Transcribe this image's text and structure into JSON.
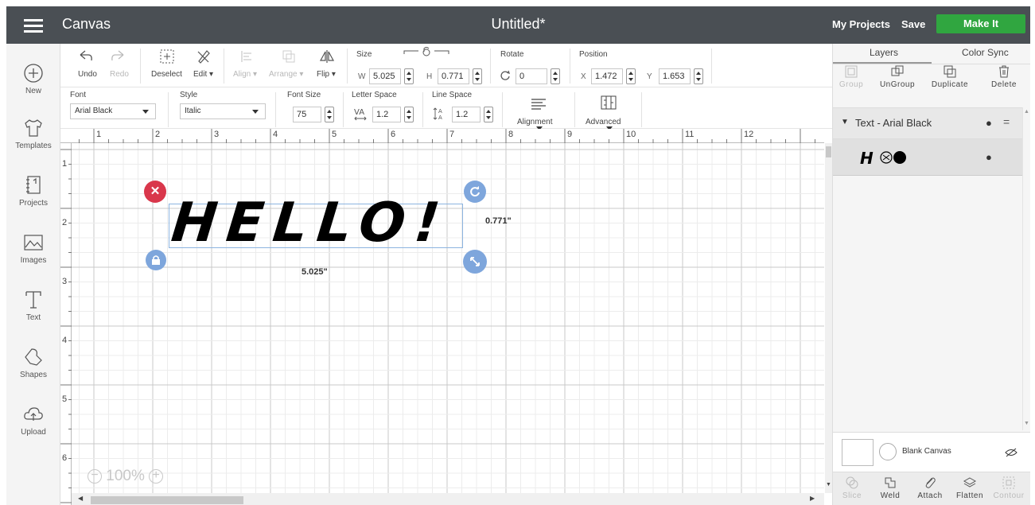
{
  "header": {
    "app_title": "Canvas",
    "doc_title": "Untitled*",
    "my_projects": "My Projects",
    "save": "Save",
    "make_it": "Make It"
  },
  "sidebar": {
    "items": [
      {
        "label": "New",
        "icon": "plus-circle-icon"
      },
      {
        "label": "Templates",
        "icon": "shirt-icon"
      },
      {
        "label": "Projects",
        "icon": "notebook-icon"
      },
      {
        "label": "Images",
        "icon": "image-icon"
      },
      {
        "label": "Text",
        "icon": "text-icon"
      },
      {
        "label": "Shapes",
        "icon": "shapes-icon"
      },
      {
        "label": "Upload",
        "icon": "cloud-upload-icon"
      }
    ]
  },
  "toolbar": {
    "undo": "Undo",
    "redo": "Redo",
    "deselect": "Deselect",
    "edit": "Edit",
    "align": "Align",
    "arrange": "Arrange",
    "flip": "Flip",
    "size_label": "Size",
    "w_label": "W",
    "w_value": "5.025",
    "h_label": "H",
    "h_value": "0.771",
    "rotate_label": "Rotate",
    "rotate_value": "0",
    "position_label": "Position",
    "x_label": "X",
    "x_value": "1.472",
    "y_label": "Y",
    "y_value": "1.653"
  },
  "text_toolbar": {
    "font_label": "Font",
    "font_value": "Arial Black",
    "style_label": "Style",
    "style_value": "Italic",
    "font_size_label": "Font Size",
    "font_size_value": "75",
    "letter_space_label": "Letter Space",
    "letter_space_value": "1.2",
    "line_space_label": "Line Space",
    "line_space_value": "1.2",
    "alignment_label": "Alignment",
    "advanced_label": "Advanced"
  },
  "canvas": {
    "ruler_top": [
      "1",
      "2",
      "3",
      "4",
      "5",
      "6",
      "7",
      "8",
      "9",
      "10",
      "11",
      "12"
    ],
    "ruler_left": [
      "1",
      "2",
      "3",
      "4",
      "5",
      "6"
    ],
    "text": "HELLO!",
    "width_dim": "5.025\"",
    "height_dim": "0.771\"",
    "zoom": "100%"
  },
  "layers_panel": {
    "tab_layers": "Layers",
    "tab_color_sync": "Color Sync",
    "group": "Group",
    "ungroup": "UnGroup",
    "duplicate": "Duplicate",
    "delete": "Delete",
    "layer_name": "Text - Arial Black",
    "blank_canvas": "Blank Canvas",
    "slice": "Slice",
    "weld": "Weld",
    "attach": "Attach",
    "flatten": "Flatten",
    "contour": "Contour"
  },
  "colors": {
    "topbar": "#4a4f54",
    "make_it": "#30a640",
    "delete_handle": "#d9374b",
    "handle_blue": "#7ea6dc"
  }
}
